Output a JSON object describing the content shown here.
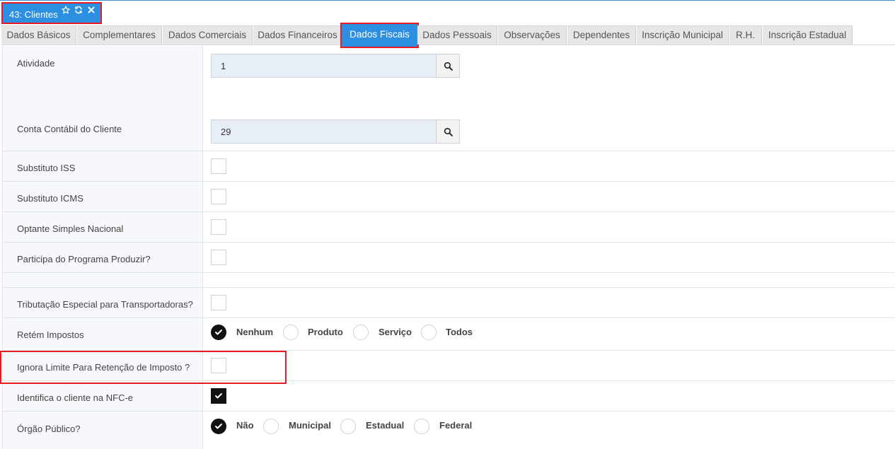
{
  "window_tab": {
    "title": "43: Clientes",
    "icons": [
      "star-icon",
      "refresh-icon",
      "close-icon"
    ]
  },
  "tabs": [
    {
      "label": "Dados Básicos",
      "active": false
    },
    {
      "label": "Complementares",
      "active": false
    },
    {
      "label": "Dados Comerciais",
      "active": false
    },
    {
      "label": "Dados Financeiros",
      "active": false
    },
    {
      "label": "Dados Fiscais",
      "active": true
    },
    {
      "label": "Dados Pessoais",
      "active": false
    },
    {
      "label": "Observações",
      "active": false
    },
    {
      "label": "Dependentes",
      "active": false
    },
    {
      "label": "Inscrição Municipal",
      "active": false
    },
    {
      "label": "R.H.",
      "active": false
    },
    {
      "label": "Inscrição Estadual",
      "active": false
    }
  ],
  "form": {
    "atividade": {
      "label": "Atividade",
      "value": "1"
    },
    "conta_contabil": {
      "label": "Conta Contábil do Cliente",
      "value": "29"
    },
    "substituto_iss": {
      "label": "Substituto ISS",
      "checked": false
    },
    "substituto_icms": {
      "label": "Substituto ICMS",
      "checked": false
    },
    "optante_simples": {
      "label": "Optante Simples Nacional",
      "checked": false
    },
    "programa_produzir": {
      "label": "Participa do Programa Produzir?",
      "checked": false
    },
    "tributacao_transportadoras": {
      "label": "Tributação Especial para Transportadoras?",
      "checked": false
    },
    "retem_impostos": {
      "label": "Retém Impostos",
      "options": [
        "Nenhum",
        "Produto",
        "Serviço",
        "Todos"
      ],
      "selected": "Nenhum"
    },
    "ignora_limite": {
      "label": "Ignora Limite Para Retenção de Imposto ?",
      "checked": false
    },
    "identifica_nfce": {
      "label": "Identifica o cliente na NFC-e",
      "checked": true
    },
    "orgao_publico": {
      "label": "Órgão Público?",
      "options": [
        "Não",
        "Municipal",
        "Estadual",
        "Federal"
      ],
      "selected": "Não"
    }
  },
  "colors": {
    "accent": "#2d8fe2",
    "highlight": "#e51c23",
    "label_bg": "#f6f8fb",
    "input_bg": "#e8eef6"
  }
}
